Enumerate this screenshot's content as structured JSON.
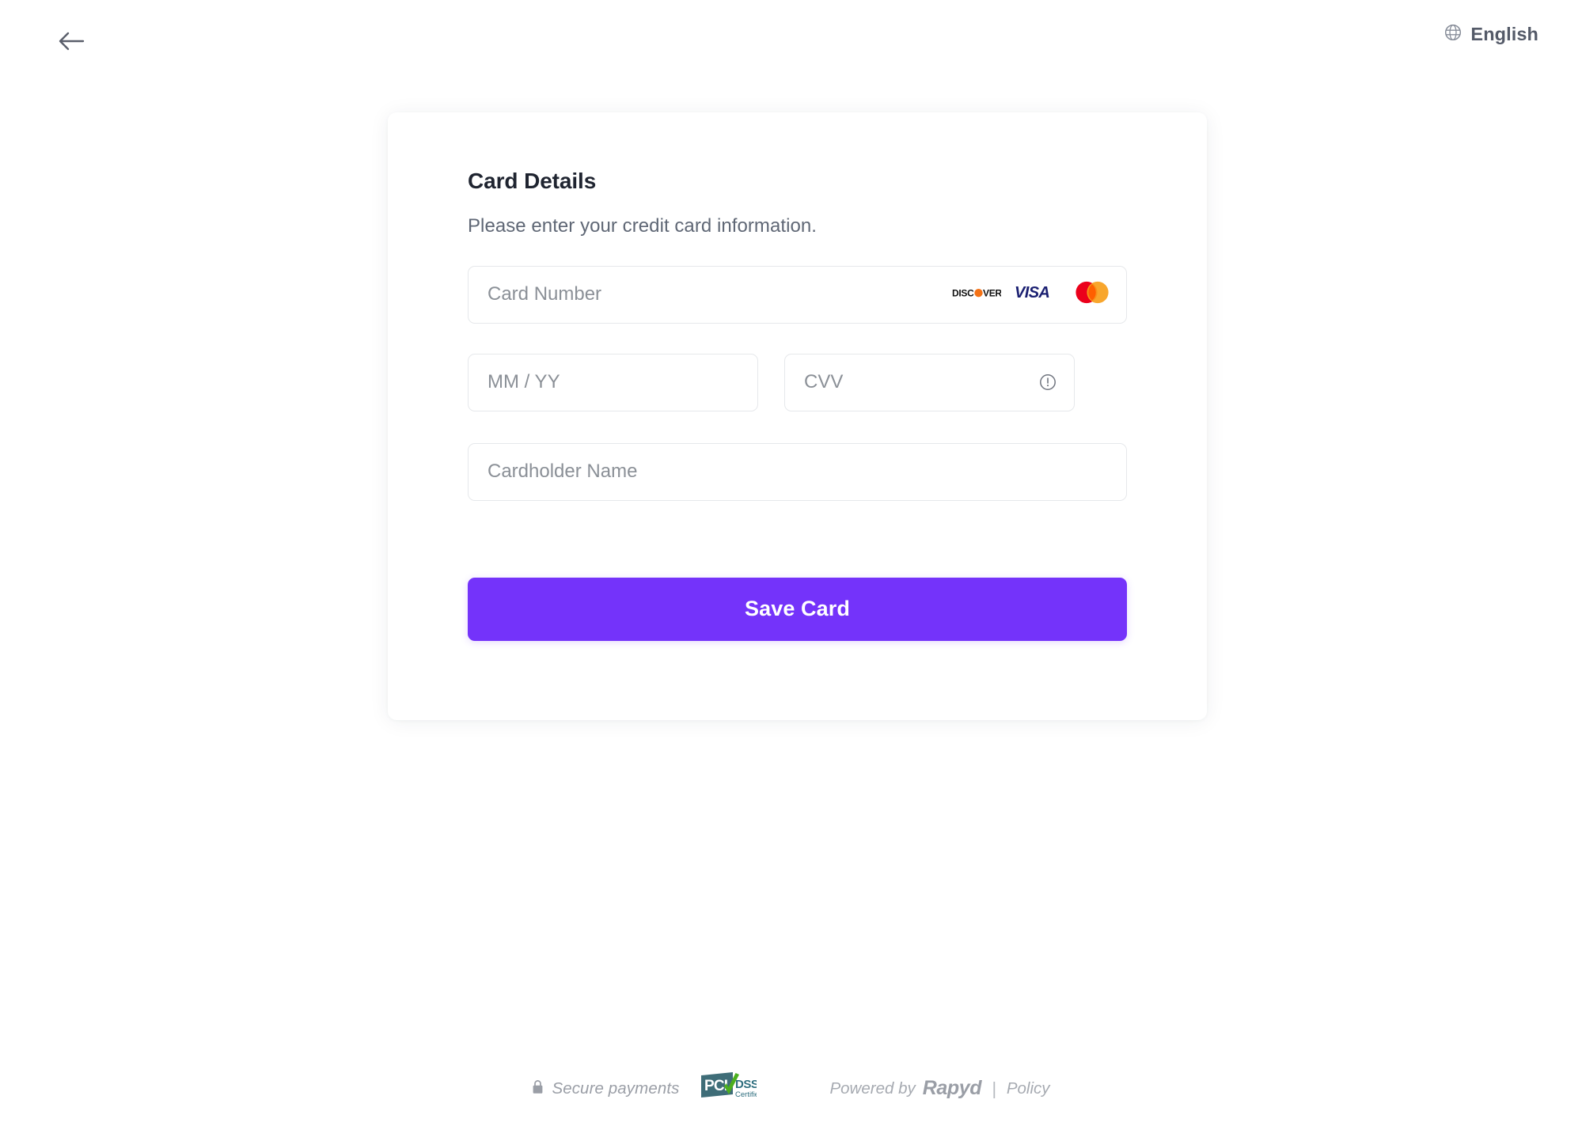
{
  "header": {
    "back_icon": "arrow-left-icon",
    "language": {
      "icon": "globe-icon",
      "label": "English"
    }
  },
  "card": {
    "title": "Card Details",
    "subtitle": "Please enter your credit card information.",
    "fields": {
      "card_number": {
        "placeholder": "Card Number",
        "value": ""
      },
      "expiry": {
        "placeholder": "MM / YY",
        "value": ""
      },
      "cvv": {
        "placeholder": "CVV",
        "value": "",
        "info_icon": "exclamation-circle-icon"
      },
      "cardholder_name": {
        "placeholder": "Cardholder Name",
        "value": ""
      }
    },
    "accepted_brands": [
      {
        "name": "discover",
        "label": "DISCOVER"
      },
      {
        "name": "visa",
        "label": "VISA"
      },
      {
        "name": "mastercard",
        "label": "Mastercard"
      }
    ],
    "submit_label": "Save Card"
  },
  "footer": {
    "lock_icon": "lock-icon",
    "secure_text": "Secure payments",
    "pci_badge": {
      "name": "pci-dss-certified-badge",
      "pci": "PCI",
      "dss": "DSS",
      "certified": "Certified"
    },
    "powered_by": "Powered by",
    "brand": "Rapyd",
    "divider": "|",
    "policy": "Policy"
  },
  "colors": {
    "accent": "#7433fa",
    "title": "#1f2430",
    "subtitle": "#5f6775",
    "placeholder": "#8b9097",
    "border": "#e6e8eb",
    "footer_text": "#9a9ea6",
    "visa_blue": "#1a1f71",
    "mastercard_red": "#eb001b",
    "mastercard_orange": "#f79e1b",
    "discover_orange": "#f47216",
    "pci_teal": "#2e6e7e",
    "pci_green": "#4caf1e"
  }
}
